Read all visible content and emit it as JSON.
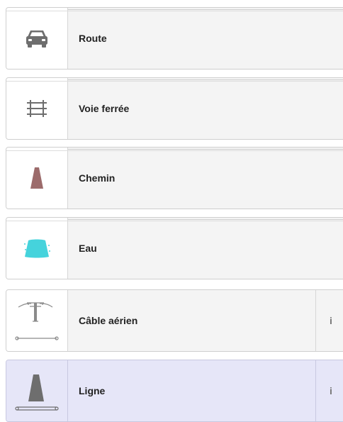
{
  "items": [
    {
      "label": "Route",
      "icon": "car-icon",
      "has_info": false,
      "selected": false
    },
    {
      "label": "Voie ferrée",
      "icon": "railway-icon",
      "has_info": false,
      "selected": false
    },
    {
      "label": "Chemin",
      "icon": "path-icon",
      "has_info": false,
      "selected": false
    },
    {
      "label": "Eau",
      "icon": "water-icon",
      "has_info": false,
      "selected": false
    },
    {
      "label": "Câble aérien",
      "icon": "aerial-cable-icon",
      "has_info": true,
      "info_label": "i",
      "selected": false
    },
    {
      "label": "Ligne",
      "icon": "line-icon",
      "has_info": true,
      "info_label": "i",
      "selected": true
    }
  ],
  "colors": {
    "path": "#9c6b6b",
    "water": "#45d3dc",
    "icon_gray": "#6e6e6e",
    "selected_bg": "#e6e6f8"
  }
}
